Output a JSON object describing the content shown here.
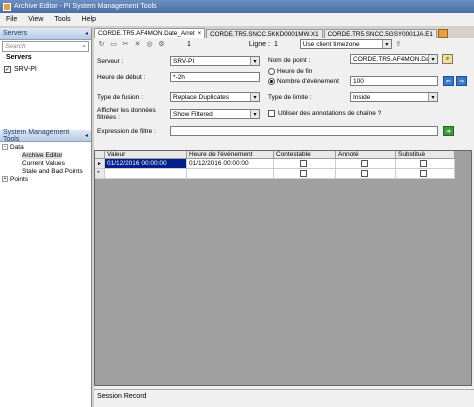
{
  "window": {
    "title": "Archive Editor - PI System Management Tools"
  },
  "menu": [
    "File",
    "View",
    "Tools",
    "Help"
  ],
  "left": {
    "servers_header": "Servers",
    "search_placeholder": "Search",
    "servers_label": "Servers",
    "server_name": "SRV-PI",
    "smt_header": "System Management Tools",
    "tree": [
      {
        "label": "Data",
        "level": 0,
        "expander": "−"
      },
      {
        "label": "Archive Editor",
        "level": 1,
        "selected": true
      },
      {
        "label": "Current Values",
        "level": 1
      },
      {
        "label": "Stale and Bad Points",
        "level": 1
      },
      {
        "label": "Points",
        "level": 0,
        "expander": "+"
      }
    ]
  },
  "tabs": [
    {
      "label": "CORDE.TR5.AF4MON.Date_Arret",
      "active": true
    },
    {
      "label": "CORDE.TR5.SNCC.5KKD0001MW.X1"
    },
    {
      "label": "CORDE.TR5.SNCC.5GSY0001JA.E1"
    }
  ],
  "toolbar": {
    "count": "1",
    "ligne_label": "Ligne :",
    "ligne_value": "1",
    "timezone": "Use client timezone"
  },
  "form": {
    "serveur_label": "Serveur :",
    "serveur_value": "SRV-PI",
    "nom_point_label": "Nom de point :",
    "nom_point_value": "CORDE.TR5.AF4MON.Da",
    "heure_debut_label": "Heure de début :",
    "heure_debut_value": "*-2h",
    "heure_fin_label": "Heure de fin",
    "nombre_evt_label": "Nombre d'événement",
    "nombre_evt_value": "100",
    "type_fusion_label": "Type de fusion :",
    "type_fusion_value": "Replace Duplicates",
    "type_limite_label": "Type de limite :",
    "type_limite_value": "Inside",
    "afficher_label_1": "Afficher les données",
    "afficher_label_2": "filtrées :",
    "afficher_value": "Show Filtered",
    "annotations_label": "Utiliser des annotations de chaîne ?",
    "expression_label": "Expression de filtre :",
    "expression_value": ""
  },
  "grid": {
    "headers": [
      "Valeur",
      "Heure de l'événement",
      "Contestable",
      "Annoté",
      "Substitué"
    ],
    "rows": [
      {
        "marker": "►",
        "valeur": "01/12/2016 00:00:00",
        "heure": "01/12/2016 00:00:00"
      },
      {
        "marker": "*",
        "valeur": "",
        "heure": ""
      }
    ]
  },
  "session": {
    "label": "Session Record"
  }
}
